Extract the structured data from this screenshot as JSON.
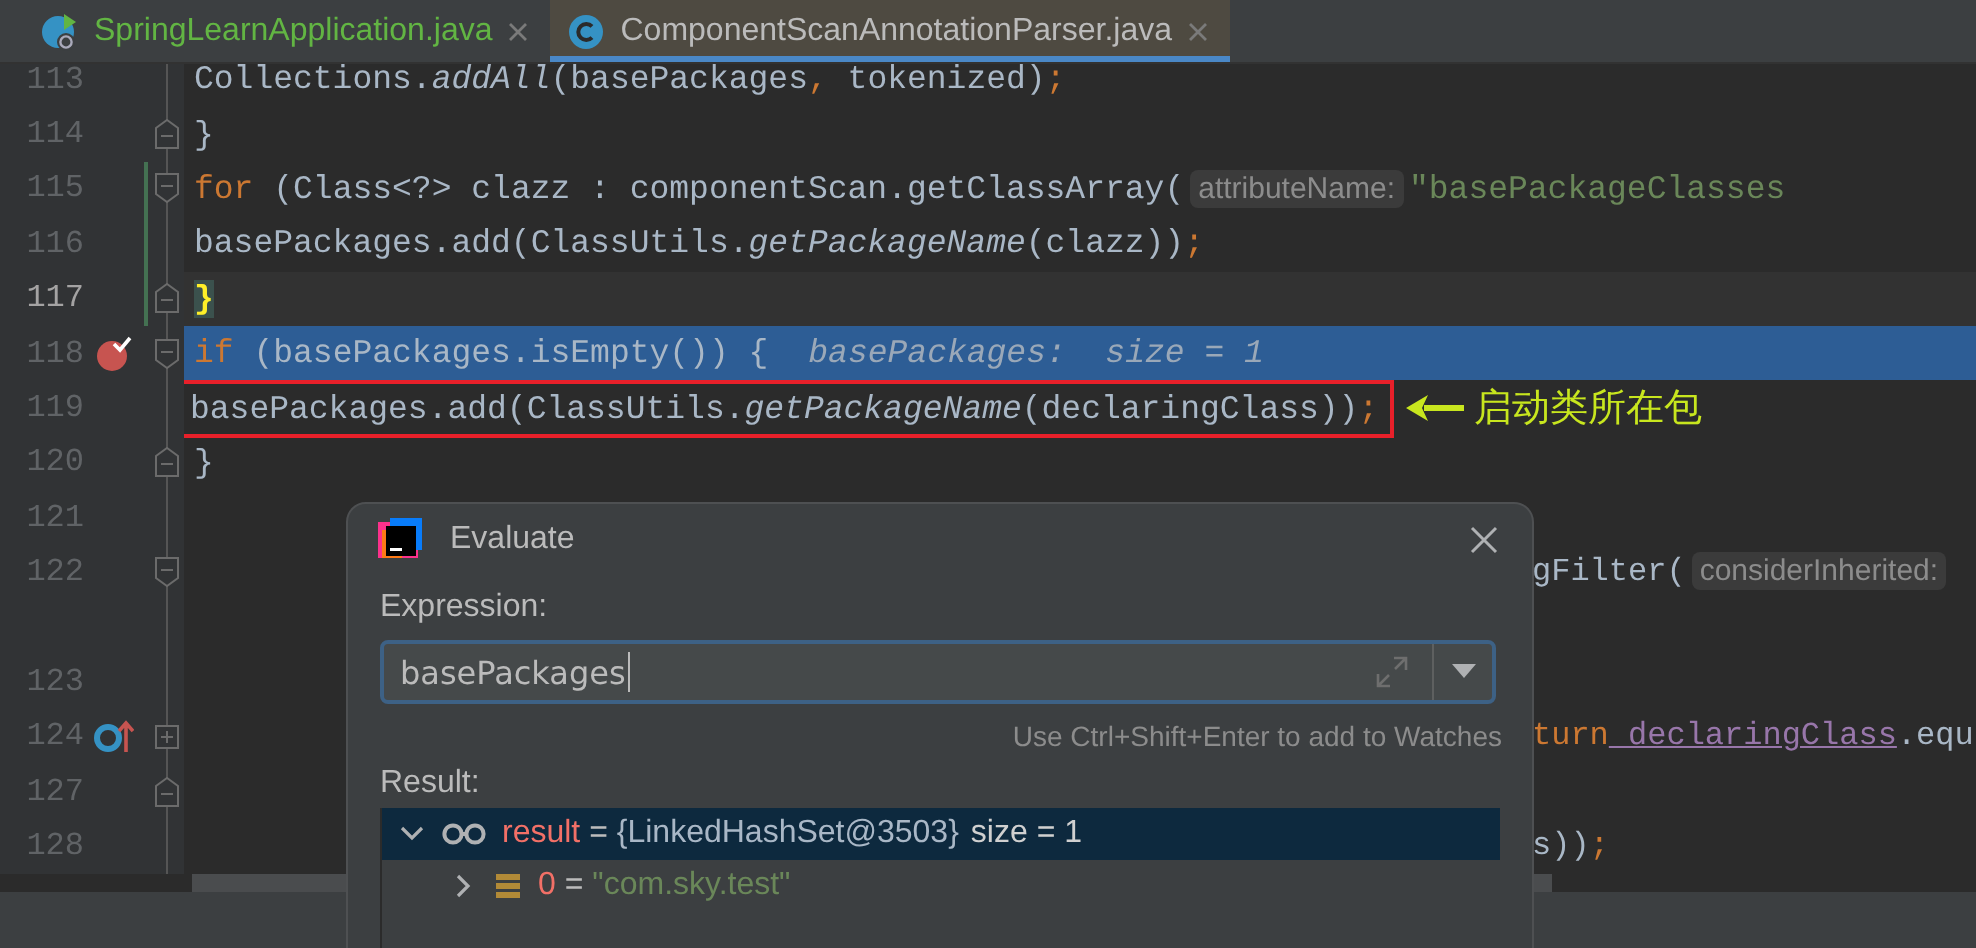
{
  "tabs": [
    {
      "label": "SpringLearnApplication.java",
      "kind": "app",
      "selected": false,
      "color": "#62b543"
    },
    {
      "label": "ComponentScanAnnotationParser.java",
      "kind": "class",
      "selected": true,
      "color": "#bbbbbb"
    }
  ],
  "editor": {
    "lines": [
      {
        "kind": "line",
        "number": "113",
        "tokens": [
          {
            "kind": "plain",
            "text": "            Collections."
          },
          {
            "kind": "static",
            "text": "addAll"
          },
          {
            "kind": "plain",
            "text": "(basePackages"
          },
          {
            "kind": "punct",
            "text": ","
          },
          {
            "kind": "plain",
            "text": " tokenized)"
          },
          {
            "kind": "punct",
            "text": ";"
          }
        ]
      },
      {
        "kind": "line",
        "number": "114",
        "fold_end": true,
        "tokens": [
          {
            "kind": "plain",
            "text": "        }"
          }
        ]
      },
      {
        "kind": "line",
        "number": "115",
        "fold_start": true,
        "changed": true,
        "tokens": [
          {
            "kind": "keyword",
            "text": "        for"
          },
          {
            "kind": "plain",
            "text": " (Class<?> clazz : componentScan.getClassArray("
          },
          {
            "kind": "hint",
            "text": "attributeName:"
          },
          {
            "kind": "string",
            "text": "\"basePackageClasses"
          }
        ]
      },
      {
        "kind": "line",
        "number": "116",
        "changed": true,
        "tokens": [
          {
            "kind": "plain",
            "text": "            basePackages.add(ClassUtils."
          },
          {
            "kind": "static",
            "text": "getPackageName"
          },
          {
            "kind": "plain",
            "text": "(clazz))"
          },
          {
            "kind": "punct",
            "text": ";"
          }
        ]
      },
      {
        "kind": "line",
        "number": "117",
        "fold_end": true,
        "changed": true,
        "caret_line": true,
        "tokens": [
          {
            "kind": "match",
            "text": "        }"
          }
        ]
      },
      {
        "kind": "line",
        "number": "118",
        "fold_start": true,
        "breakpoint": true,
        "execution_point": true,
        "tokens": [
          {
            "kind": "keyword",
            "text": "        if"
          },
          {
            "kind": "plain",
            "text": " (basePackages.isEmpty()) {"
          },
          {
            "kind": "debug",
            "text": "basePackages:  size = 1"
          }
        ]
      },
      {
        "kind": "line",
        "number": "119",
        "boxed": true,
        "annotation": "启动类所在包",
        "tokens": [
          {
            "kind": "plain",
            "text": "            basePackages.add(ClassUtils."
          },
          {
            "kind": "static",
            "text": "getPackageName"
          },
          {
            "kind": "plain",
            "text": "(declaringClass))"
          },
          {
            "kind": "punct",
            "text": ";"
          }
        ]
      },
      {
        "kind": "line",
        "number": "120",
        "fold_end": true,
        "tokens": [
          {
            "kind": "plain",
            "text": "        }"
          }
        ]
      },
      {
        "kind": "line",
        "number": "121"
      },
      {
        "kind": "line",
        "number": "122",
        "fold_start": true,
        "covered": true,
        "tokens": [
          {
            "kind": "plain",
            "text": "gFilter("
          },
          {
            "kind": "hint",
            "text": "considerInherited:"
          }
        ]
      },
      {
        "kind": "continuation"
      },
      {
        "kind": "line",
        "number": "123"
      },
      {
        "kind": "line",
        "number": "124",
        "collapsed": true,
        "override_marker": true,
        "covered": true,
        "tokens": [
          {
            "kind": "keyword",
            "text": "turn"
          },
          {
            "kind": "field",
            "text": " declaringClass"
          },
          {
            "kind": "plain",
            "text": ".equ"
          }
        ]
      },
      {
        "kind": "line",
        "number": "127",
        "fold_end": true
      },
      {
        "kind": "line",
        "number": "128",
        "covered": true,
        "tokens": [
          {
            "kind": "plain",
            "text": "s))"
          },
          {
            "kind": "punct",
            "text": ";"
          }
        ]
      }
    ]
  },
  "evaluate_dialog": {
    "title": "Evaluate",
    "expression_label": "Expression:",
    "expression": "basePackages",
    "hint": "Use Ctrl+Shift+Enter to add to Watches",
    "result_label": "Result:",
    "result": [
      {
        "kind": "watch",
        "name": "result",
        "separator": "=",
        "value": {
          "kind": "object",
          "text": "{LinkedHashSet@3503}"
        },
        "extra": "size = 1",
        "expanded": true,
        "selected": true,
        "children": [
          {
            "kind": "element",
            "name": "0",
            "separator": "=",
            "value": {
              "kind": "string",
              "text": "\"com.sky.test\""
            },
            "expanded": false,
            "selected": false
          }
        ]
      }
    ]
  }
}
